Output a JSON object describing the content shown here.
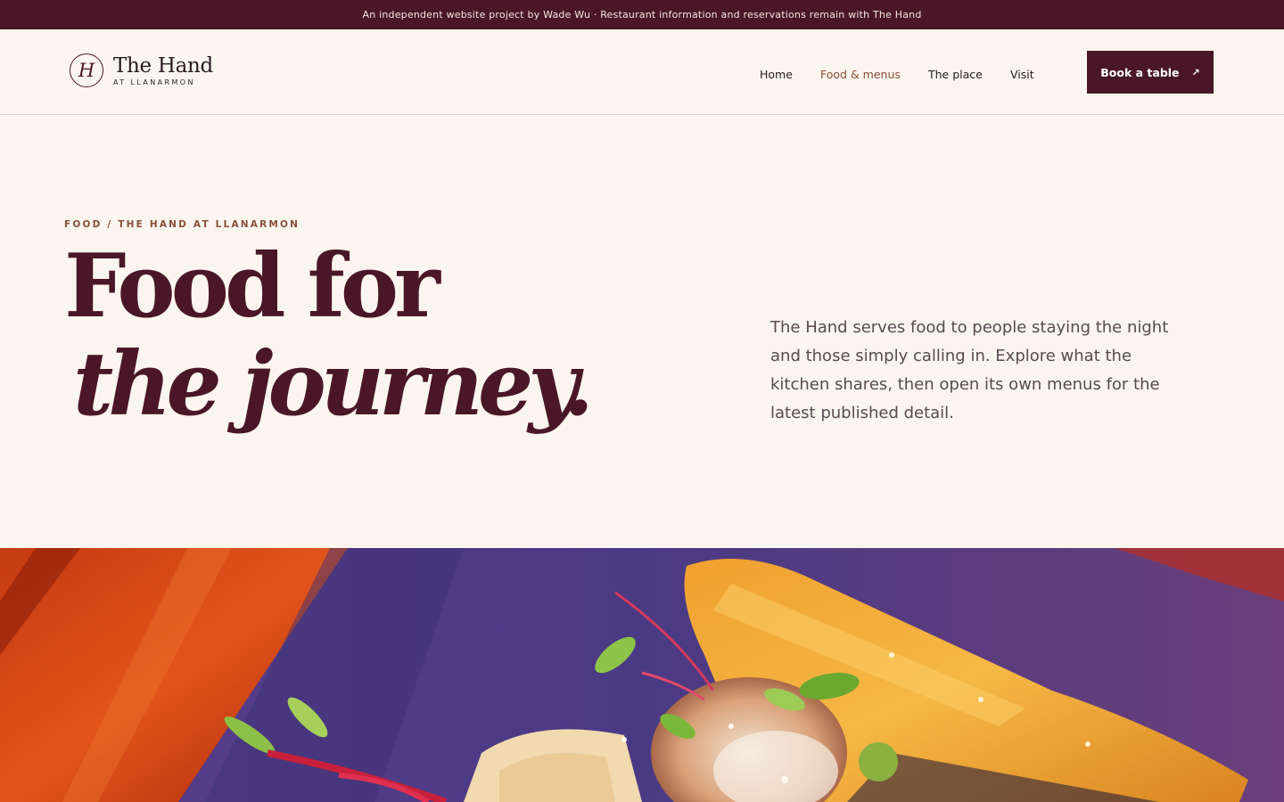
{
  "announcement": "An independent website project by Wade Wu · Restaurant information and reservations remain with The Hand",
  "logo": {
    "mark": "H",
    "name": "The Hand",
    "subtitle": "AT LLANARMON"
  },
  "nav": {
    "items": [
      {
        "label": "Home",
        "active": false
      },
      {
        "label": "Food & menus",
        "active": true
      },
      {
        "label": "The place",
        "active": false
      },
      {
        "label": "Visit",
        "active": false
      }
    ],
    "cta_label": "Book a table",
    "cta_icon": "arrow-up-right-icon"
  },
  "hero": {
    "eyebrow": "FOOD / THE HAND AT LLANARMON",
    "headline_line1": "Food for",
    "headline_line2": "the journey.",
    "intro": "The Hand serves food to people staying the night and those simply calling in. Explore what the kitchen shares, then open its own menus for the latest published detail."
  },
  "image": {
    "description_icon": "food-photo"
  },
  "colors": {
    "brand": "#4a1728",
    "accent": "#8a4f3a",
    "background": "#faf5ee"
  }
}
